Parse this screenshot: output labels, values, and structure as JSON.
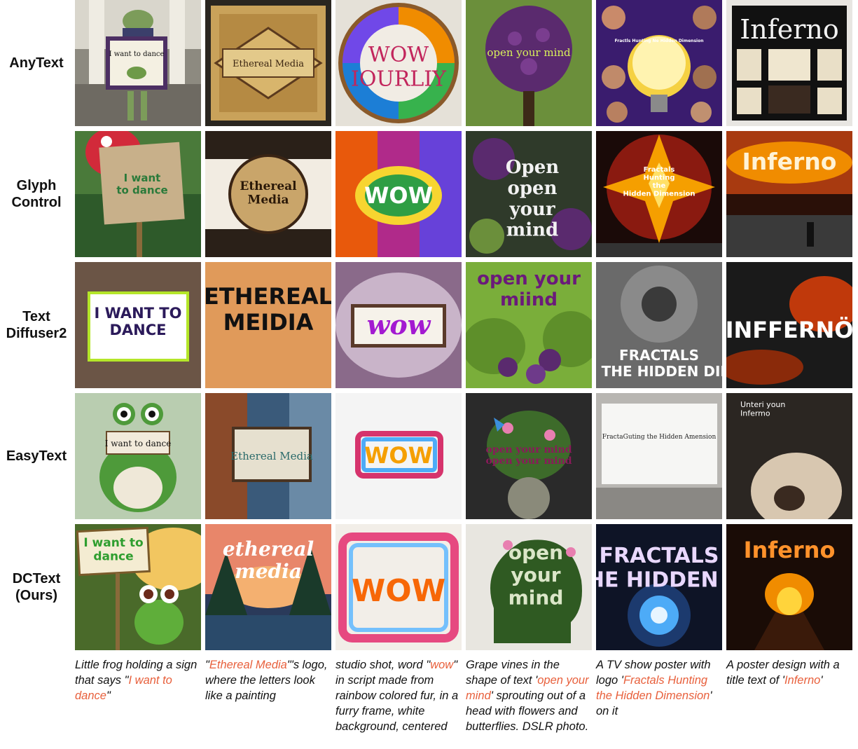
{
  "rows": [
    {
      "label": "AnyText"
    },
    {
      "label": "Glyph\nControl"
    },
    {
      "label": "Text\nDiffuser2"
    },
    {
      "label": "EasyText"
    },
    {
      "label": "DCText\n(Ours)"
    }
  ],
  "cells": [
    [
      "I want to dance",
      "Ethereal Media",
      "WOW\nIOURLIY",
      "open your mind",
      "Fractls Hunting Ne Hidden Dimension",
      "Inferno"
    ],
    [
      "I want\nto dance",
      "Ethereal\nMedia",
      "WOW",
      "Open\nopen\nyour\nmind",
      "Fractals\nHunting\nthe\nHidden Dimension",
      "Inferno"
    ],
    [
      "I WANT TO\nDANCE",
      "ETHEREAL\nMEIDIA",
      "wow",
      "open your\nmiind",
      "FRACTALS\nHUNTING THE HIDDEN DIMENSION",
      "INFFERNÖ"
    ],
    [
      "I want to dance",
      "Ethereal Media",
      "WOW",
      "open your mind\nopen your mind",
      "FractaGuting the Hidden Amension",
      "Unteri youn\nInfermo"
    ],
    [
      "I want to\ndance",
      "ethereal\nmedia",
      "WOW",
      "open\nyour\nmind",
      "FRACTALS\nHUNTING THE HIDDEN DIMENSION",
      "Inferno"
    ]
  ],
  "captions": [
    {
      "pre": "Little frog holding a sign that says \"",
      "hl": "I want to dance",
      "post": "\""
    },
    {
      "pre": "\"",
      "hl": "Ethereal Media",
      "post": "\"'s logo, where the letters look like a painting"
    },
    {
      "pre": "studio shot, word \"",
      "hl": "wow",
      "post": "\" in script made from rainbow colored fur, in a furry frame, white background, centered"
    },
    {
      "pre": "Grape vines in the shape of text '",
      "hl": "open your mind",
      "post": "' sprouting out of a head with flowers and butterflies. DSLR photo."
    },
    {
      "pre": "A TV show poster with logo '",
      "hl": "Fractals Hunting the Hidden Dimension",
      "post": "' on it"
    },
    {
      "pre": "A poster design with a title text of '",
      "hl": "Inferno",
      "post": "'"
    }
  ],
  "colors": {
    "highlight": "#e8603c"
  }
}
